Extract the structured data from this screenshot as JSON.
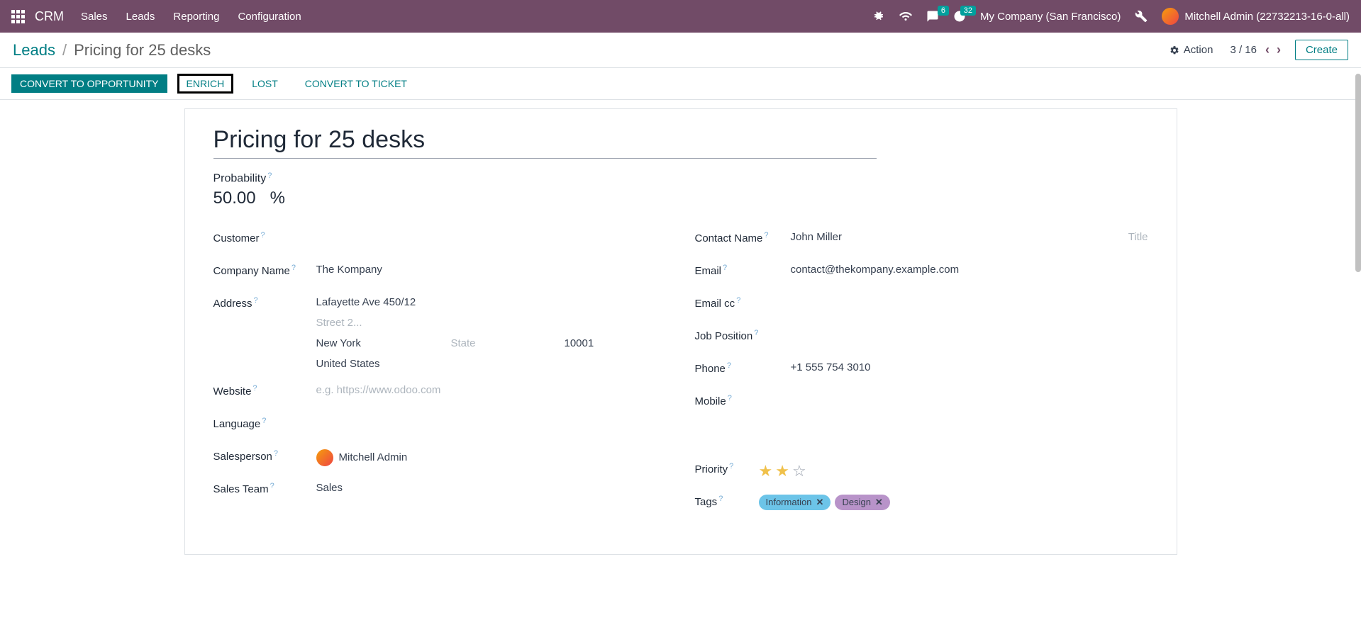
{
  "navbar": {
    "brand": "CRM",
    "menu": [
      "Sales",
      "Leads",
      "Reporting",
      "Configuration"
    ],
    "messages_badge": "6",
    "activities_badge": "32",
    "company": "My Company (San Francisco)",
    "user": "Mitchell Admin (22732213-16-0-all)"
  },
  "breadcrumb": {
    "root": "Leads",
    "current": "Pricing for 25 desks"
  },
  "controlbar": {
    "action_label": "Action",
    "pager": "3 / 16",
    "create_label": "Create"
  },
  "statusbar": {
    "convert_opp": "CONVERT TO OPPORTUNITY",
    "enrich": "ENRICH",
    "lost": "LOST",
    "convert_ticket": "CONVERT TO TICKET"
  },
  "lead": {
    "title": "Pricing for 25 desks",
    "probability_label": "Probability",
    "probability_value": "50.00",
    "probability_unit": "%"
  },
  "left": {
    "customer_label": "Customer",
    "company_name_label": "Company Name",
    "company_name": "The Kompany",
    "address_label": "Address",
    "street": "Lafayette Ave 450/12",
    "street2_placeholder": "Street 2...",
    "city": "New York",
    "state_placeholder": "State",
    "zip": "10001",
    "country": "United States",
    "website_label": "Website",
    "website_placeholder": "e.g. https://www.odoo.com",
    "language_label": "Language",
    "salesperson_label": "Salesperson",
    "salesperson": "Mitchell Admin",
    "salesteam_label": "Sales Team",
    "salesteam": "Sales"
  },
  "right": {
    "contact_name_label": "Contact Name",
    "contact_name": "John Miller",
    "title_placeholder": "Title",
    "email_label": "Email",
    "email": "contact@thekompany.example.com",
    "email_cc_label": "Email cc",
    "job_position_label": "Job Position",
    "phone_label": "Phone",
    "phone": "+1 555 754 3010",
    "mobile_label": "Mobile",
    "priority_label": "Priority",
    "priority_stars": 2,
    "priority_max": 3,
    "tags_label": "Tags",
    "tags": [
      {
        "label": "Information",
        "class": "info"
      },
      {
        "label": "Design",
        "class": "design"
      }
    ]
  }
}
